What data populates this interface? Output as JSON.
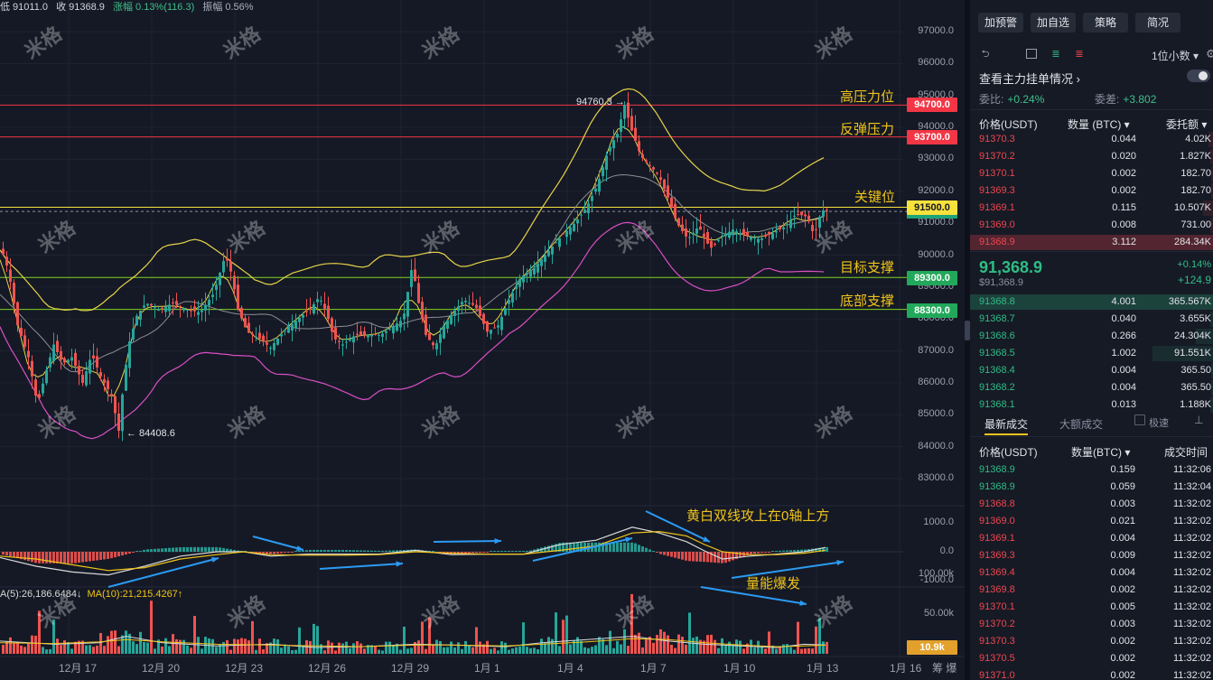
{
  "header": {
    "low": "低 91011.0",
    "close": "收 91368.9",
    "change": "涨幅 0.13%(116.3)",
    "amplitude": "振幅 0.56%"
  },
  "y_axis": [
    "97000.0",
    "96000.0",
    "95000.0",
    "94000.0",
    "93000.0",
    "92000.0",
    "91000.0",
    "90000.0",
    "89000.0",
    "88000.0",
    "87000.0",
    "86000.0",
    "85000.0",
    "84000.0",
    "83000.0"
  ],
  "macd_axis": [
    "1000.0",
    "0.0",
    "-1000.0"
  ],
  "vol_axis": [
    "100.00k",
    "50.00k"
  ],
  "price_tags": {
    "p94700": "94700.0",
    "p93700": "93700.0",
    "p91500": "91500.0",
    "p89300": "89300.0",
    "p88300": "88300.0",
    "vol": "10.9k"
  },
  "annotations": {
    "high_resistance": "高压力位",
    "rebound_resistance": "反弹压力",
    "key_level": "关键位",
    "target_support": "目标支撑",
    "bottom_support": "底部支撑",
    "macd_note": "黄白双线攻上在0轴上方",
    "volume_note": "量能爆发"
  },
  "marks": {
    "high": "94760.3 →",
    "low": "← 84408.6"
  },
  "ma_legend": {
    "ma5": "A(5):26,186.6484↓",
    "ma10": "MA(10):21,215.4267↑"
  },
  "x_axis": [
    "12月 17",
    "12月 20",
    "12月 23",
    "12月 26",
    "12月 29",
    "1月 1",
    "1月 4",
    "1月 7",
    "1月 10",
    "1月 13",
    "1月 16"
  ],
  "axis_corner": "筹 爆",
  "watermark": "米格",
  "chart_data": {
    "type": "candlestick",
    "title": "",
    "xlabel": "",
    "ylabel": "",
    "ylim": [
      82600,
      97600
    ],
    "x": [
      "12月 17",
      "12月 20",
      "12月 23",
      "12月 26",
      "12月 29",
      "1月 1",
      "1月 4",
      "1月 7",
      "1月 10",
      "1月 13",
      "1月 16"
    ],
    "high_mark": 94760.3,
    "low_mark": 84408.6,
    "last_close": 91368.9,
    "horizontal_levels": [
      94700,
      93700,
      91500,
      89300,
      88300
    ],
    "price_path": [
      [
        0,
        90200
      ],
      [
        8,
        89500
      ],
      [
        18,
        87800
      ],
      [
        30,
        86800
      ],
      [
        40,
        85300
      ],
      [
        48,
        86200
      ],
      [
        58,
        87200
      ],
      [
        68,
        86600
      ],
      [
        78,
        86800
      ],
      [
        90,
        86000
      ],
      [
        100,
        86900
      ],
      [
        110,
        86200
      ],
      [
        122,
        85600
      ],
      [
        130,
        84500
      ],
      [
        136,
        86200
      ],
      [
        142,
        87300
      ],
      [
        150,
        88100
      ],
      [
        160,
        88500
      ],
      [
        175,
        88300
      ],
      [
        190,
        88500
      ],
      [
        205,
        88300
      ],
      [
        220,
        88200
      ],
      [
        235,
        88800
      ],
      [
        248,
        90000
      ],
      [
        255,
        89400
      ],
      [
        262,
        88300
      ],
      [
        272,
        87600
      ],
      [
        285,
        87400
      ],
      [
        298,
        87100
      ],
      [
        312,
        87600
      ],
      [
        328,
        88000
      ],
      [
        342,
        88300
      ],
      [
        352,
        88700
      ],
      [
        360,
        88200
      ],
      [
        368,
        87400
      ],
      [
        378,
        87200
      ],
      [
        392,
        87500
      ],
      [
        408,
        87500
      ],
      [
        420,
        87500
      ],
      [
        435,
        87800
      ],
      [
        445,
        88000
      ],
      [
        455,
        89700
      ],
      [
        462,
        88500
      ],
      [
        470,
        87500
      ],
      [
        480,
        87100
      ],
      [
        490,
        87800
      ],
      [
        500,
        88200
      ],
      [
        512,
        88600
      ],
      [
        525,
        88400
      ],
      [
        538,
        87600
      ],
      [
        550,
        87800
      ],
      [
        562,
        88600
      ],
      [
        575,
        89300
      ],
      [
        590,
        89600
      ],
      [
        605,
        90100
      ],
      [
        620,
        90600
      ],
      [
        635,
        91000
      ],
      [
        648,
        91500
      ],
      [
        660,
        92200
      ],
      [
        672,
        93300
      ],
      [
        682,
        93800
      ],
      [
        690,
        94700
      ],
      [
        698,
        93900
      ],
      [
        708,
        93100
      ],
      [
        718,
        92800
      ],
      [
        728,
        92500
      ],
      [
        738,
        91800
      ],
      [
        748,
        91000
      ],
      [
        760,
        90500
      ],
      [
        772,
        90900
      ],
      [
        785,
        90200
      ],
      [
        798,
        90600
      ],
      [
        810,
        90800
      ],
      [
        825,
        90600
      ],
      [
        840,
        90500
      ],
      [
        855,
        90700
      ],
      [
        868,
        90900
      ],
      [
        880,
        91300
      ],
      [
        892,
        91200
      ],
      [
        900,
        90600
      ],
      [
        908,
        91400
      ],
      [
        914,
        91400
      ]
    ],
    "macd": {
      "dif": [
        [
          0,
          -200
        ],
        [
          40,
          -500
        ],
        [
          80,
          -700
        ],
        [
          120,
          -800
        ],
        [
          160,
          -500
        ],
        [
          200,
          -150
        ],
        [
          240,
          0
        ],
        [
          270,
          0
        ],
        [
          300,
          -150
        ],
        [
          340,
          -80
        ],
        [
          380,
          -80
        ],
        [
          420,
          -80
        ],
        [
          460,
          50
        ],
        [
          500,
          -100
        ],
        [
          540,
          -80
        ],
        [
          580,
          -80
        ],
        [
          620,
          250
        ],
        [
          660,
          400
        ],
        [
          700,
          850
        ],
        [
          730,
          650
        ],
        [
          760,
          350
        ],
        [
          780,
          30
        ],
        [
          800,
          -250
        ],
        [
          830,
          -150
        ],
        [
          860,
          -80
        ],
        [
          890,
          0
        ],
        [
          914,
          150
        ]
      ],
      "dea": [
        [
          0,
          -150
        ],
        [
          40,
          -250
        ],
        [
          80,
          -450
        ],
        [
          120,
          -650
        ],
        [
          160,
          -550
        ],
        [
          200,
          -250
        ],
        [
          240,
          -100
        ],
        [
          270,
          0
        ],
        [
          300,
          -100
        ],
        [
          340,
          -120
        ],
        [
          380,
          -120
        ],
        [
          420,
          -100
        ],
        [
          460,
          0
        ],
        [
          500,
          -50
        ],
        [
          540,
          -80
        ],
        [
          580,
          -80
        ],
        [
          620,
          50
        ],
        [
          660,
          200
        ],
        [
          700,
          650
        ],
        [
          730,
          700
        ],
        [
          760,
          550
        ],
        [
          780,
          250
        ],
        [
          800,
          0
        ],
        [
          830,
          -100
        ],
        [
          860,
          -100
        ],
        [
          890,
          -50
        ],
        [
          914,
          50
        ]
      ]
    },
    "volume_ma": {
      "ma5": [
        [
          0,
          16000
        ],
        [
          60,
          12000
        ],
        [
          110,
          14000
        ],
        [
          140,
          22000
        ],
        [
          180,
          14000
        ],
        [
          240,
          10000
        ],
        [
          300,
          12000
        ],
        [
          350,
          8000
        ],
        [
          400,
          9000
        ],
        [
          460,
          12000
        ],
        [
          500,
          11000
        ],
        [
          560,
          9000
        ],
        [
          600,
          14000
        ],
        [
          650,
          18000
        ],
        [
          700,
          22000
        ],
        [
          740,
          16000
        ],
        [
          780,
          12000
        ],
        [
          820,
          10000
        ],
        [
          860,
          8000
        ],
        [
          890,
          12000
        ],
        [
          914,
          11000
        ]
      ],
      "ma10": [
        [
          0,
          14000
        ],
        [
          60,
          13000
        ],
        [
          110,
          15000
        ],
        [
          140,
          18000
        ],
        [
          180,
          15000
        ],
        [
          240,
          12000
        ],
        [
          300,
          11000
        ],
        [
          350,
          10000
        ],
        [
          400,
          9000
        ],
        [
          460,
          11000
        ],
        [
          500,
          11000
        ],
        [
          560,
          10000
        ],
        [
          600,
          12000
        ],
        [
          650,
          15000
        ],
        [
          700,
          19000
        ],
        [
          740,
          18000
        ],
        [
          780,
          14000
        ],
        [
          820,
          11000
        ],
        [
          860,
          9000
        ],
        [
          890,
          10000
        ],
        [
          914,
          10900
        ]
      ]
    }
  },
  "panel": {
    "buttons": [
      "加预警",
      "加自选",
      "策略",
      "简况"
    ],
    "decimal_select": "1位小数",
    "main_force_label": "查看主力挂单情况 ›",
    "ratio_label": "委比:",
    "ratio_value": "+0.24%",
    "diff_label": "委差:",
    "diff_value": "+3.802",
    "ob_headers": [
      "价格(USDT)",
      "数量 (BTC) ▾",
      "委托额 ▾"
    ],
    "asks": [
      [
        "91370.3",
        "0.044",
        "4.02K",
        0.02
      ],
      [
        "91370.2",
        "0.020",
        "1.827K",
        0.01
      ],
      [
        "91370.1",
        "0.002",
        "182.70",
        0.005
      ],
      [
        "91369.3",
        "0.002",
        "182.70",
        0.005
      ],
      [
        "91369.1",
        "0.115",
        "10.507K",
        0.04
      ],
      [
        "91369.0",
        "0.008",
        "731.00",
        0.01
      ],
      [
        "91368.9",
        "3.112",
        "284.34K",
        1.0
      ]
    ],
    "last_price": "91,368.9",
    "last_sub": "$91,368.9",
    "last_pct": "+0.14%",
    "last_chg": "+124.9",
    "bids": [
      [
        "91368.8",
        "4.001",
        "365.567K",
        1.0
      ],
      [
        "91368.7",
        "0.040",
        "3.655K",
        0.01
      ],
      [
        "91368.6",
        "0.266",
        "24.304K",
        0.07
      ],
      [
        "91368.5",
        "1.002",
        "91.551K",
        0.25
      ],
      [
        "91368.4",
        "0.004",
        "365.50",
        0.005
      ],
      [
        "91368.2",
        "0.004",
        "365.50",
        0.005
      ],
      [
        "91368.1",
        "0.013",
        "1.188K",
        0.01
      ]
    ],
    "tabs": [
      "最新成交",
      "大额成交"
    ],
    "fast_label": "极速",
    "trade_headers": [
      "价格(USDT)",
      "数量(BTC) ▾",
      "成交时间"
    ],
    "trades": [
      [
        "91368.9",
        "0.159",
        "11:32:06",
        "g"
      ],
      [
        "91368.9",
        "0.059",
        "11:32:04",
        "g"
      ],
      [
        "91368.8",
        "0.003",
        "11:32:02",
        "r"
      ],
      [
        "91369.0",
        "0.021",
        "11:32:02",
        "r"
      ],
      [
        "91369.1",
        "0.004",
        "11:32:02",
        "r"
      ],
      [
        "91369.3",
        "0.009",
        "11:32:02",
        "r"
      ],
      [
        "91369.4",
        "0.004",
        "11:32:02",
        "r"
      ],
      [
        "91369.8",
        "0.002",
        "11:32:02",
        "r"
      ],
      [
        "91370.1",
        "0.005",
        "11:32:02",
        "r"
      ],
      [
        "91370.2",
        "0.003",
        "11:32:02",
        "r"
      ],
      [
        "91370.3",
        "0.002",
        "11:32:02",
        "r"
      ],
      [
        "91370.5",
        "0.002",
        "11:32:02",
        "r"
      ],
      [
        "91371.0",
        "0.002",
        "11:32:02",
        "r"
      ]
    ]
  }
}
